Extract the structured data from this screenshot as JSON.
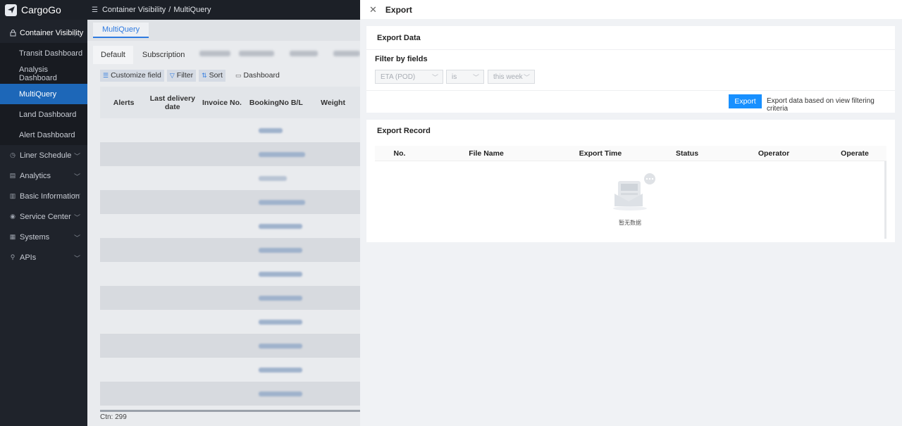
{
  "brand": {
    "name": "CargoGo"
  },
  "breadcrumb": {
    "items": [
      "Container Visibility",
      "MultiQuery"
    ]
  },
  "sidebar": {
    "group_open": {
      "label": "Container Visibility"
    },
    "submenu": [
      {
        "label": "Transit Dashboard"
      },
      {
        "label": "Analysis Dashboard"
      },
      {
        "label": "MultiQuery",
        "active": true
      },
      {
        "label": "Land Dashboard"
      },
      {
        "label": "Alert Dashboard"
      }
    ],
    "groups": [
      {
        "label": "Liner Schedule"
      },
      {
        "label": "Analytics"
      },
      {
        "label": "Basic Information"
      },
      {
        "label": "Service Center"
      },
      {
        "label": "Systems"
      },
      {
        "label": "APIs"
      }
    ]
  },
  "page": {
    "page_tab": "MultiQuery",
    "view_tabs": [
      "Default",
      "Subscription"
    ],
    "toolbar": {
      "customize_field": "Customize field",
      "filter": "Filter",
      "sort": "Sort",
      "dashboard": "Dashboard"
    },
    "table": {
      "headers": [
        "Alerts",
        "Last delivery date",
        "Invoice No.",
        "BookingNo B/L",
        "Weight"
      ]
    },
    "footer_count": "Ctn:  299"
  },
  "drawer": {
    "title": "Export",
    "export_data": {
      "title": "Export Data",
      "filter_label": "Filter by fields",
      "field_select": "ETA  (POD)",
      "operator_select": "is",
      "value_select": "this week",
      "export_button": "Export",
      "export_hint": "Export data based on view filtering criteria"
    },
    "export_record": {
      "title": "Export Record",
      "columns": [
        "No.",
        "File Name",
        "Export Time",
        "Status",
        "Operator",
        "Operate"
      ],
      "empty_text": "暂无数据"
    }
  },
  "colors": {
    "accent": "#1890ff",
    "sidebar_bg": "#1f232b",
    "active_menu": "#1d67b8"
  }
}
